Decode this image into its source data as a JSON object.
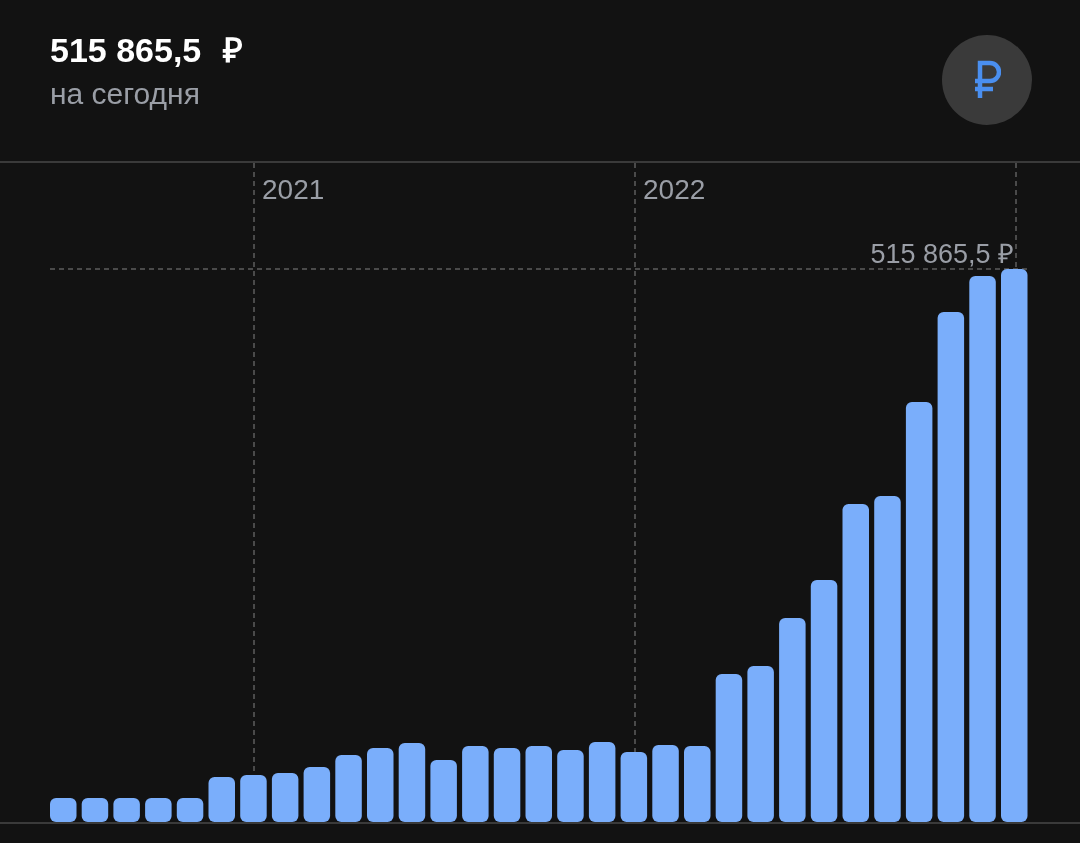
{
  "balance": {
    "amount": "515 865,5",
    "currency": "₽",
    "caption": "на сегодня"
  },
  "chart": {
    "kind": "picture",
    "year_labels": [
      "2021",
      "2022"
    ],
    "max_label": "515 865,5 ₽"
  }
}
